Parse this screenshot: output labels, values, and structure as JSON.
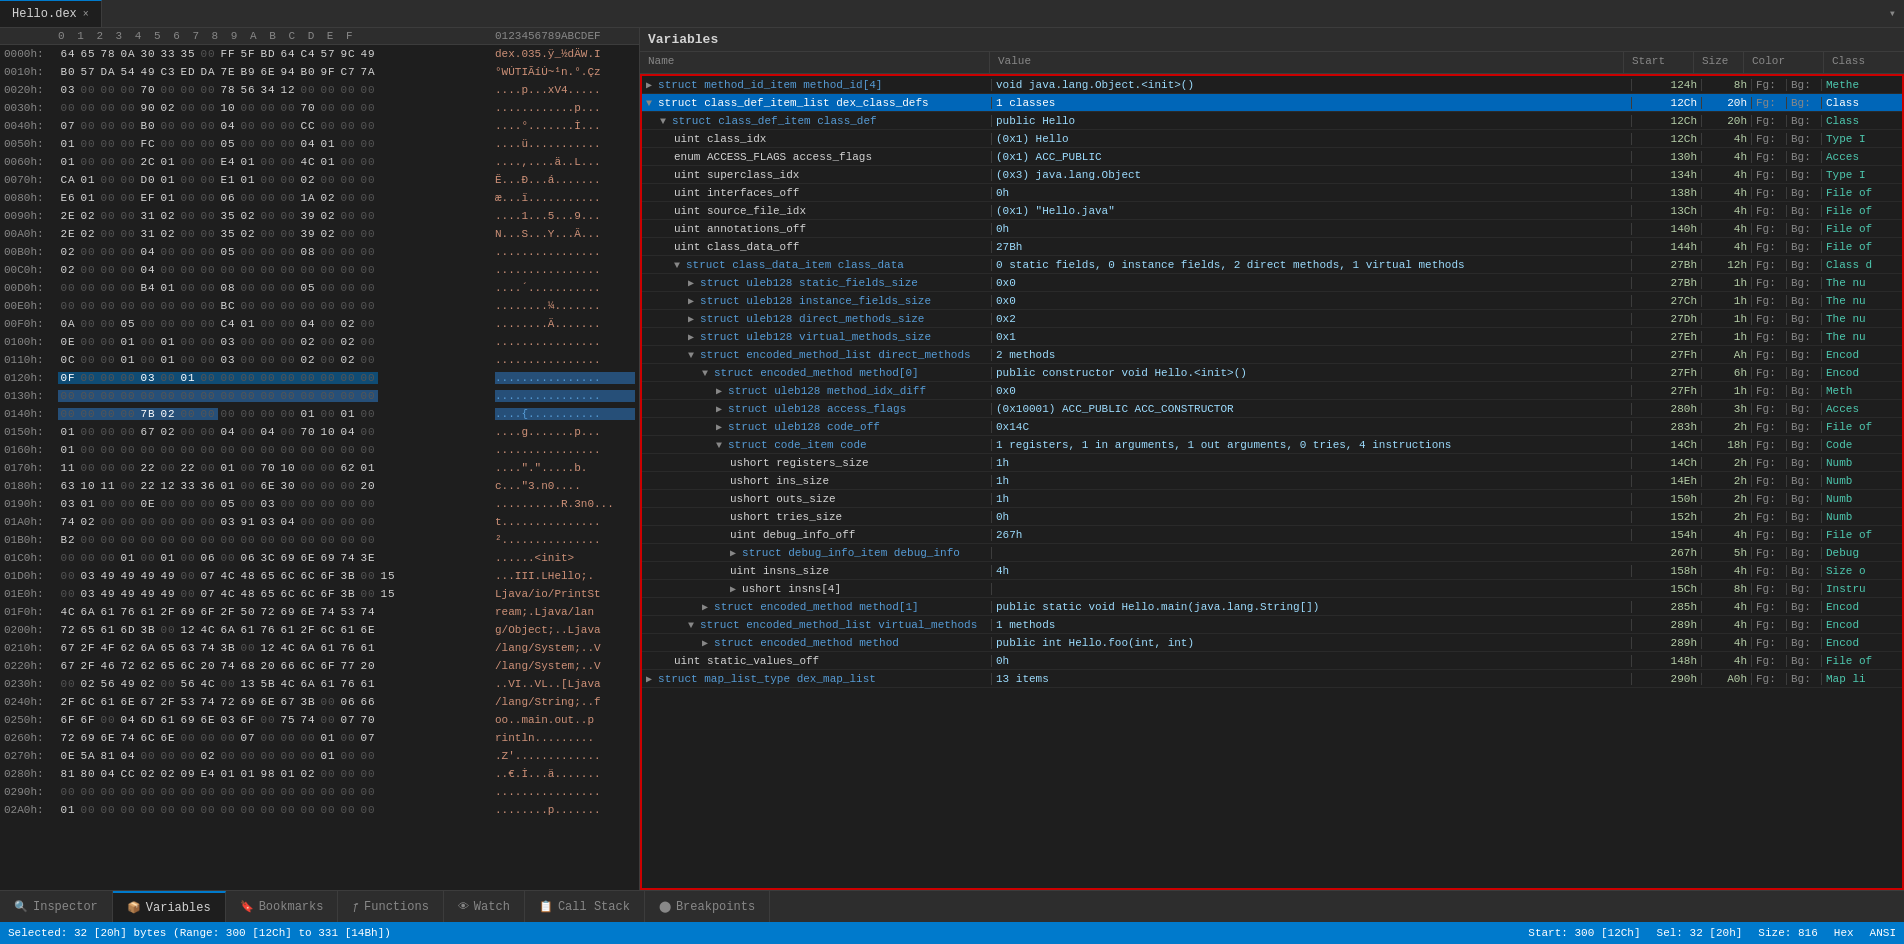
{
  "app": {
    "title": "Hello.dex",
    "tab_label": "Hello.dex",
    "tab_close": "×"
  },
  "toolbar": {
    "scroll_icon": "▾"
  },
  "hex_editor": {
    "header": {
      "addr_label": "",
      "byte_labels": "0  1  2  3  4  5  6  7  8  9  A  B  C  D  E  F",
      "ascii_label": "0123456789ABCDEF"
    },
    "rows": [
      {
        "addr": "0000h:",
        "bytes": "64 65 78 0A 30 33 35 00 FF 5F BD 64 C4 57 9C 49",
        "ascii": "dex.035.ÿ_½dÄW.I"
      },
      {
        "addr": "0010h:",
        "bytes": "B0 57 DA 54 49 C3 ED DA 7E B9 6E 94 B0 9F C7 7A",
        "ascii": "°WÚTIÃíÚ~¹n.°.Çz"
      },
      {
        "addr": "0020h:",
        "bytes": "03 00 00 00 70 00 00 00 78 56 34 12 00 00 00 00",
        "ascii": "....p...xV4....."
      },
      {
        "addr": "0030h:",
        "bytes": "00 00 00 00 90 02 00 00 10 00 00 00 70 00 00 00",
        "ascii": "............p..."
      },
      {
        "addr": "0040h:",
        "bytes": "07 00 00 00 B0 00 00 00 04 00 00 00 CC 00 00 00",
        "ascii": "....°.......Ì..."
      },
      {
        "addr": "0050h:",
        "bytes": "01 00 00 00 FC 00 00 00 05 00 00 00 04 01 00 00",
        "ascii": "....ü..........."
      },
      {
        "addr": "0060h:",
        "bytes": "01 00 00 00 2C 01 00 00 E4 01 00 00 4C 01 00 00",
        "ascii": "....,....ä..L..."
      },
      {
        "addr": "0070h:",
        "bytes": "CA 01 00 00 D0 01 00 00 E1 01 00 00 02 00 00 00",
        "ascii": "Ê...Ð...á......."
      },
      {
        "addr": "0080h:",
        "bytes": "E6 01 00 00 EF 01 00 00 06 00 00 00 1A 02 00 00",
        "ascii": "æ...ï..........."
      },
      {
        "addr": "0090h:",
        "bytes": "2E 02 00 00 31 02 00 00 35 02 00 00 39 02 00 00",
        "ascii": "....1...5...9..."
      },
      {
        "addr": "00A0h:",
        "bytes": "2E 02 00 00 31 02 00 00 35 02 00 00 39 02 00 00",
        "ascii": "N...S...Y...Â..."
      },
      {
        "addr": "00B0h:",
        "bytes": "02 00 00 00 04 00 00 00 05 00 00 00 08 00 00 00",
        "ascii": "................"
      },
      {
        "addr": "00C0h:",
        "bytes": "02 00 00 00 04 00 00 00 00 00 00 00 00 00 00 00",
        "ascii": "................"
      },
      {
        "addr": "00D0h:",
        "bytes": "00 00 00 00 B4 01 00 00 08 00 00 00 05 00 00 00",
        "ascii": "....´..........."
      },
      {
        "addr": "00E0h:",
        "bytes": "00 00 00 00 00 00 00 00 BC 00 00 00 00 00 00 00",
        "ascii": "........¼......."
      },
      {
        "addr": "00F0h:",
        "bytes": "0A 00 00 05 00 00 00 00 C4 01 00 00 04 00 02 00",
        "ascii": "........Ä......."
      },
      {
        "addr": "0100h:",
        "bytes": "0E 00 00 01 00 01 00 00 03 00 00 00 02 00 02 00",
        "ascii": "................"
      },
      {
        "addr": "0110h:",
        "bytes": "0C 00 00 01 00 01 00 00 03 00 00 00 02 00 02 00",
        "ascii": "................"
      },
      {
        "addr": "0120h:",
        "bytes": "0F 00 00 00 03 00 01 00 00 00 00 00 00 00 00 00",
        "ascii": "................"
      },
      {
        "addr": "0130h:",
        "bytes": "00 00 00 00 00 00 00 00 00 00 00 00 00 00 00 00",
        "ascii": "................"
      },
      {
        "addr": "0140h:",
        "bytes": "00 00 00 00 7B 02 00 00 00 00 00 00 01 00 01 00",
        "ascii": "....{..........."
      },
      {
        "addr": "0150h:",
        "bytes": "01 00 00 00 67 02 00 00 04 00 04 00 70 10 04 00",
        "ascii": "....g.......p..."
      },
      {
        "addr": "0160h:",
        "bytes": "01 00 00 00 00 00 00 00 00 00 00 00 00 00 00 00",
        "ascii": "................"
      },
      {
        "addr": "0170h:",
        "bytes": "11 00 00 00 22 00 22 00 01 00 70 10 00 00 62 01",
        "ascii": "....\".\".....b."
      },
      {
        "addr": "0180h:",
        "bytes": "63 10 11 00 22 12 33 36 01 00 6E 30 00 00 00 20",
        "ascii": "c...\"3.n0.... "
      },
      {
        "addr": "0190h:",
        "bytes": "03 01 00 00 0E 00 00 00 05 00 03 00 00 00 00 00",
        "ascii": "..........R.3n0..."
      },
      {
        "addr": "01A0h:",
        "bytes": "74 02 00 00 00 00 00 00 03 91 03 04 00 00 00 00",
        "ascii": "t..............."
      },
      {
        "addr": "01B0h:",
        "bytes": "B2 00 00 00 00 00 00 00 00 00 00 00 00 00 00 00",
        "ascii": "²..............."
      },
      {
        "addr": "01C0h:",
        "bytes": "00 00 00 01 00 01 00 06 00 06 3C 69 6E 69 74 3E",
        "ascii": "......<init>"
      },
      {
        "addr": "01D0h:",
        "bytes": "00 03 49 49 49 49 00 07 4C 48 65 6C 6C 6F 3B 00 15",
        "ascii": "...III.LHello;."
      },
      {
        "addr": "01E0h:",
        "bytes": "00 03 49 49 49 49 00 07 4C 48 65 6C 6C 6F 3B 00 15",
        "ascii": "Ljava/io/PrintSt"
      },
      {
        "addr": "01F0h:",
        "bytes": "4C 6A 61 76 61 2F 69 6F 2F 50 72 69 6E 74 53 74",
        "ascii": "ream;.Ljava/lan"
      },
      {
        "addr": "0200h:",
        "bytes": "72 65 61 6D 3B 00 12 4C 6A 61 76 61 2F 6C 61 6E",
        "ascii": "g/Object;..Ljava"
      },
      {
        "addr": "0210h:",
        "bytes": "67 2F 4F 62 6A 65 63 74 3B 00 12 4C 6A 61 76 61",
        "ascii": "/lang/System;..V"
      },
      {
        "addr": "0220h:",
        "bytes": "67 2F 46 72 62 65 6C 20 74 68 20 66 6C 6F 77 20",
        "ascii": "/lang/System;..V"
      },
      {
        "addr": "0230h:",
        "bytes": "00 02 56 49 02 00 56 4C 00 13 5B 4C 6A 61 76 61",
        "ascii": "..VI..VL..[Ljava"
      },
      {
        "addr": "0240h:",
        "bytes": "2F 6C 61 6E 67 2F 53 74 72 69 6E 67 3B 00 06 66",
        "ascii": "/lang/String;..f"
      },
      {
        "addr": "0250h:",
        "bytes": "6F 6F 00 04 6D 61 69 6E 03 6F 00 75 74 00 07 70",
        "ascii": "oo..main.out..p"
      },
      {
        "addr": "0260h:",
        "bytes": "72 69 6E 74 6C 6E 00 00 00 07 00 00 00 01 00 07",
        "ascii": "rintln........."
      },
      {
        "addr": "0270h:",
        "bytes": "0E 5A 81 04 00 00 00 02 00 00 00 00 00 01 00 00",
        "ascii": ".Z'............."
      },
      {
        "addr": "0280h:",
        "bytes": "81 80 04 CC 02 02 09 E4 01 01 98 01 02 00 00 00",
        "ascii": "..€.Ì...ä......."
      },
      {
        "addr": "0290h:",
        "bytes": "00 00 00 00 00 00 00 00 00 00 00 00 00 00 00 00",
        "ascii": "................"
      },
      {
        "addr": "02A0h:",
        "bytes": "01 00 00 00 00 00 00 00 00 00 00 00 00 00 00 00",
        "ascii": "........p......."
      }
    ]
  },
  "variables": {
    "panel_title": "Variables",
    "columns": {
      "name": "Name",
      "value": "Value",
      "start": "Start",
      "size": "Size",
      "color": "Color",
      "class": "Class"
    },
    "rows": [
      {
        "indent": 0,
        "expanded": true,
        "toggle": "▶",
        "name": "struct method_id_item method_id[4]",
        "value": "void java.lang.Object.<init>()",
        "start": "124h",
        "size": "8h",
        "fg": "Fg:",
        "bg": "Bg:",
        "class": "Methe",
        "selected": false,
        "name_type": "keyword"
      },
      {
        "indent": 0,
        "expanded": true,
        "toggle": "▼",
        "name": "struct class_def_item_list dex_class_defs",
        "value": "1 classes",
        "start": "12Ch",
        "size": "20h",
        "fg": "Fg:",
        "bg": "Bg:",
        "class": "Class",
        "selected": true,
        "name_type": "keyword"
      },
      {
        "indent": 1,
        "expanded": true,
        "toggle": "▼",
        "name": "struct class_def_item class_def",
        "value": "public Hello",
        "start": "12Ch",
        "size": "20h",
        "fg": "Fg:",
        "bg": "Bg:",
        "class": "Class",
        "selected": false,
        "name_type": "keyword"
      },
      {
        "indent": 2,
        "expanded": false,
        "toggle": "",
        "name": "uint class_idx",
        "value": "(0x1) Hello",
        "start": "12Ch",
        "size": "4h",
        "fg": "Fg:",
        "bg": "Bg:",
        "class": "Type I",
        "selected": false,
        "name_type": "field"
      },
      {
        "indent": 2,
        "expanded": false,
        "toggle": "",
        "name": "enum ACCESS_FLAGS access_flags",
        "value": "(0x1) ACC_PUBLIC",
        "start": "130h",
        "size": "4h",
        "fg": "Fg:",
        "bg": "Bg:",
        "class": "Acces",
        "selected": false,
        "name_type": "field"
      },
      {
        "indent": 2,
        "expanded": false,
        "toggle": "",
        "name": "uint superclass_idx",
        "value": "(0x3) java.lang.Object",
        "start": "134h",
        "size": "4h",
        "fg": "Fg:",
        "bg": "Bg:",
        "class": "Type I",
        "selected": false,
        "name_type": "field"
      },
      {
        "indent": 2,
        "expanded": false,
        "toggle": "",
        "name": "uint interfaces_off",
        "value": "0h",
        "start": "138h",
        "size": "4h",
        "fg": "Fg:",
        "bg": "Bg:",
        "class": "File of",
        "selected": false,
        "name_type": "field"
      },
      {
        "indent": 2,
        "expanded": false,
        "toggle": "",
        "name": "uint source_file_idx",
        "value": "(0x1) \"Hello.java\"",
        "start": "13Ch",
        "size": "4h",
        "fg": "Fg:",
        "bg": "Bg:",
        "class": "File of",
        "selected": false,
        "name_type": "field"
      },
      {
        "indent": 2,
        "expanded": false,
        "toggle": "",
        "name": "uint annotations_off",
        "value": "0h",
        "start": "140h",
        "size": "4h",
        "fg": "Fg:",
        "bg": "Bg:",
        "class": "File of",
        "selected": false,
        "name_type": "field"
      },
      {
        "indent": 2,
        "expanded": false,
        "toggle": "",
        "name": "uint class_data_off",
        "value": "27Bh",
        "start": "144h",
        "size": "4h",
        "fg": "Fg:",
        "bg": "Bg:",
        "class": "File of",
        "selected": false,
        "name_type": "field"
      },
      {
        "indent": 2,
        "expanded": true,
        "toggle": "▼",
        "name": "struct class_data_item class_data",
        "value": "0 static fields, 0 instance fields, 2 direct methods, 1 virtual methods",
        "start": "27Bh",
        "size": "12h",
        "fg": "Fg:",
        "bg": "Bg:",
        "class": "Class d",
        "selected": false,
        "name_type": "keyword"
      },
      {
        "indent": 3,
        "expanded": false,
        "toggle": "▶",
        "name": "struct uleb128 static_fields_size",
        "value": "0x0",
        "start": "27Bh",
        "size": "1h",
        "fg": "Fg:",
        "bg": "Bg:",
        "class": "The nu",
        "selected": false,
        "name_type": "keyword"
      },
      {
        "indent": 3,
        "expanded": false,
        "toggle": "▶",
        "name": "struct uleb128 instance_fields_size",
        "value": "0x0",
        "start": "27Ch",
        "size": "1h",
        "fg": "Fg:",
        "bg": "Bg:",
        "class": "The nu",
        "selected": false,
        "name_type": "keyword"
      },
      {
        "indent": 3,
        "expanded": false,
        "toggle": "▶",
        "name": "struct uleb128 direct_methods_size",
        "value": "0x2",
        "start": "27Dh",
        "size": "1h",
        "fg": "Fg:",
        "bg": "Bg:",
        "class": "The nu",
        "selected": false,
        "name_type": "keyword"
      },
      {
        "indent": 3,
        "expanded": false,
        "toggle": "▶",
        "name": "struct uleb128 virtual_methods_size",
        "value": "0x1",
        "start": "27Eh",
        "size": "1h",
        "fg": "Fg:",
        "bg": "Bg:",
        "class": "The nu",
        "selected": false,
        "name_type": "keyword"
      },
      {
        "indent": 3,
        "expanded": true,
        "toggle": "▼",
        "name": "struct encoded_method_list direct_methods",
        "value": "2 methods",
        "start": "27Fh",
        "size": "Ah",
        "fg": "Fg:",
        "bg": "Bg:",
        "class": "Encod",
        "selected": false,
        "name_type": "keyword"
      },
      {
        "indent": 4,
        "expanded": true,
        "toggle": "▼",
        "name": "struct encoded_method method[0]",
        "value": "public constructor void Hello.<init>()",
        "start": "27Fh",
        "size": "6h",
        "fg": "Fg:",
        "bg": "Bg:",
        "class": "Encod",
        "selected": false,
        "name_type": "keyword"
      },
      {
        "indent": 5,
        "expanded": false,
        "toggle": "▶",
        "name": "struct uleb128 method_idx_diff",
        "value": "0x0",
        "start": "27Fh",
        "size": "1h",
        "fg": "Fg:",
        "bg": "Bg:",
        "class": "Meth",
        "selected": false,
        "name_type": "keyword"
      },
      {
        "indent": 5,
        "expanded": false,
        "toggle": "▶",
        "name": "struct uleb128 access_flags",
        "value": "(0x10001) ACC_PUBLIC ACC_CONSTRUCTOR",
        "start": "280h",
        "size": "3h",
        "fg": "Fg:",
        "bg": "Bg:",
        "class": "Acces",
        "selected": false,
        "name_type": "keyword"
      },
      {
        "indent": 5,
        "expanded": false,
        "toggle": "▶",
        "name": "struct uleb128 code_off",
        "value": "0x14C",
        "start": "283h",
        "size": "2h",
        "fg": "Fg:",
        "bg": "Bg:",
        "class": "File of",
        "selected": false,
        "name_type": "keyword"
      },
      {
        "indent": 5,
        "expanded": true,
        "toggle": "▼",
        "name": "struct code_item code",
        "value": "1 registers, 1 in arguments, 1 out arguments, 0 tries, 4 instructions",
        "start": "14Ch",
        "size": "18h",
        "fg": "Fg:",
        "bg": "Bg:",
        "class": "Code",
        "selected": false,
        "name_type": "keyword"
      },
      {
        "indent": 6,
        "expanded": false,
        "toggle": "",
        "name": "ushort registers_size",
        "value": "1h",
        "start": "14Ch",
        "size": "2h",
        "fg": "Fg:",
        "bg": "Bg:",
        "class": "Numb",
        "selected": false,
        "name_type": "field"
      },
      {
        "indent": 6,
        "expanded": false,
        "toggle": "",
        "name": "ushort ins_size",
        "value": "1h",
        "start": "14Eh",
        "size": "2h",
        "fg": "Fg:",
        "bg": "Bg:",
        "class": "Numb",
        "selected": false,
        "name_type": "field"
      },
      {
        "indent": 6,
        "expanded": false,
        "toggle": "",
        "name": "ushort outs_size",
        "value": "1h",
        "start": "150h",
        "size": "2h",
        "fg": "Fg:",
        "bg": "Bg:",
        "class": "Numb",
        "selected": false,
        "name_type": "field"
      },
      {
        "indent": 6,
        "expanded": false,
        "toggle": "",
        "name": "ushort tries_size",
        "value": "0h",
        "start": "152h",
        "size": "2h",
        "fg": "Fg:",
        "bg": "Bg:",
        "class": "Numb",
        "selected": false,
        "name_type": "field"
      },
      {
        "indent": 6,
        "expanded": false,
        "toggle": "",
        "name": "uint debug_info_off",
        "value": "267h",
        "start": "154h",
        "size": "4h",
        "fg": "Fg:",
        "bg": "Bg:",
        "class": "File of",
        "selected": false,
        "name_type": "field"
      },
      {
        "indent": 6,
        "expanded": true,
        "toggle": "▶",
        "name": "struct debug_info_item debug_info",
        "value": "",
        "start": "267h",
        "size": "5h",
        "fg": "Fg:",
        "bg": "Bg:",
        "class": "Debug",
        "selected": false,
        "name_type": "keyword"
      },
      {
        "indent": 6,
        "expanded": false,
        "toggle": "",
        "name": "uint insns_size",
        "value": "4h",
        "start": "158h",
        "size": "4h",
        "fg": "Fg:",
        "bg": "Bg:",
        "class": "Size o",
        "selected": false,
        "name_type": "field"
      },
      {
        "indent": 6,
        "expanded": false,
        "toggle": "▶",
        "name": "ushort insns[4]",
        "value": "",
        "start": "15Ch",
        "size": "8h",
        "fg": "Fg:",
        "bg": "Bg:",
        "class": "Instru",
        "selected": false,
        "name_type": "field"
      },
      {
        "indent": 4,
        "expanded": false,
        "toggle": "▶",
        "name": "struct encoded_method method[1]",
        "value": "public static void Hello.main(java.lang.String[])",
        "start": "285h",
        "size": "4h",
        "fg": "Fg:",
        "bg": "Bg:",
        "class": "Encod",
        "selected": false,
        "name_type": "keyword"
      },
      {
        "indent": 3,
        "expanded": true,
        "toggle": "▼",
        "name": "struct encoded_method_list virtual_methods",
        "value": "1 methods",
        "start": "289h",
        "size": "4h",
        "fg": "Fg:",
        "bg": "Bg:",
        "class": "Encod",
        "selected": false,
        "name_type": "keyword"
      },
      {
        "indent": 4,
        "expanded": false,
        "toggle": "▶",
        "name": "struct encoded_method method",
        "value": "public int Hello.foo(int, int)",
        "start": "289h",
        "size": "4h",
        "fg": "Fg:",
        "bg": "Bg:",
        "class": "Encod",
        "selected": false,
        "name_type": "keyword"
      },
      {
        "indent": 2,
        "expanded": false,
        "toggle": "",
        "name": "uint static_values_off",
        "value": "0h",
        "start": "148h",
        "size": "4h",
        "fg": "Fg:",
        "bg": "Bg:",
        "class": "File of",
        "selected": false,
        "name_type": "field"
      },
      {
        "indent": 0,
        "expanded": false,
        "toggle": "▶",
        "name": "struct map_list_type dex_map_list",
        "value": "13 items",
        "start": "290h",
        "size": "A0h",
        "fg": "Fg:",
        "bg": "Bg:",
        "class": "Map li",
        "selected": false,
        "name_type": "keyword"
      }
    ]
  },
  "bottom_tabs": [
    {
      "id": "inspector",
      "label": "Inspector",
      "icon": "🔍",
      "active": false
    },
    {
      "id": "variables",
      "label": "Variables",
      "icon": "📦",
      "active": true
    },
    {
      "id": "bookmarks",
      "label": "Bookmarks",
      "icon": "🔖",
      "active": false
    },
    {
      "id": "functions",
      "label": "Functions",
      "icon": "ƒ",
      "active": false
    },
    {
      "id": "watch",
      "label": "Watch",
      "icon": "👁",
      "active": false
    },
    {
      "id": "callstack",
      "label": "Call Stack",
      "icon": "📋",
      "active": false
    },
    {
      "id": "breakpoints",
      "label": "Breakpoints",
      "icon": "⬤",
      "active": false
    }
  ],
  "status_bar": {
    "left": "Selected: 32 [20h] bytes (Range: 300 [12Ch] to 331 [14Bh])",
    "right_items": [
      "Start: 300 [12Ch]",
      "Sel: 32 [20h]",
      "Size: 816",
      "Hex",
      "ANSI"
    ]
  }
}
